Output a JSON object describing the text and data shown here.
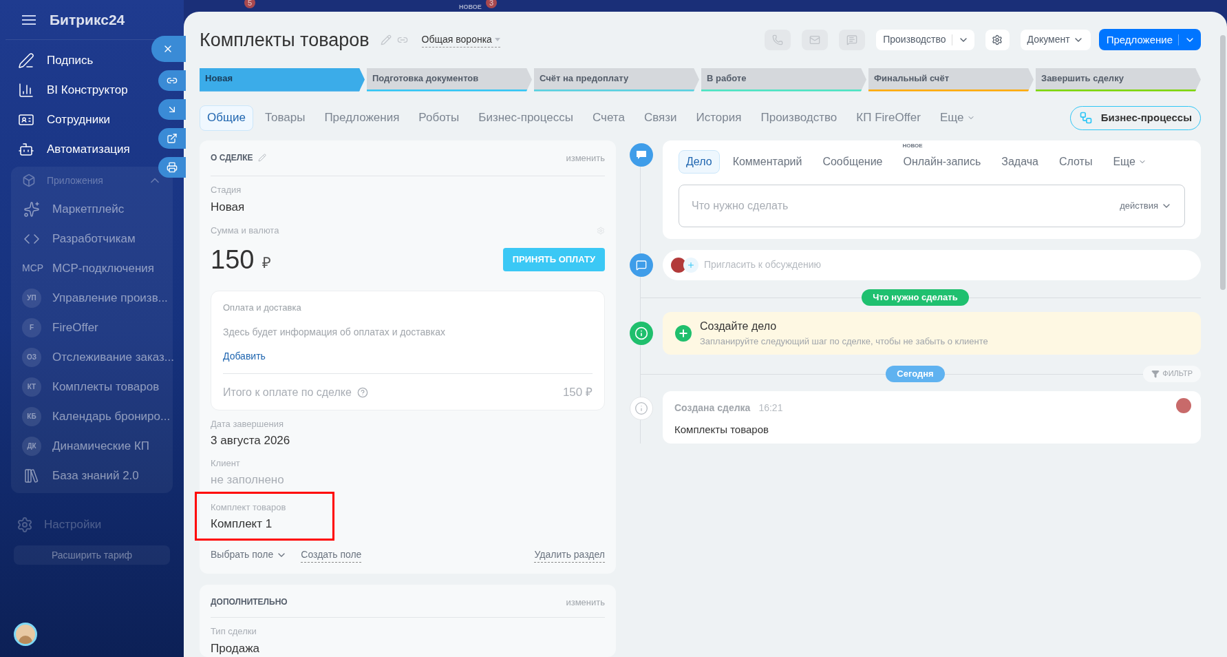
{
  "background_top": {
    "badges": [
      {
        "text": "5"
      },
      {
        "text": "3"
      }
    ],
    "new_label": "НОВОЕ"
  },
  "sidebar": {
    "logo": "Битрикс24",
    "items": [
      {
        "kind": "icon",
        "label": "Подпись",
        "dimmed": false
      },
      {
        "kind": "icon",
        "label": "BI Конструктор",
        "dimmed": false
      },
      {
        "kind": "icon",
        "label": "Сотрудники",
        "dimmed": false
      },
      {
        "kind": "icon",
        "label": "Автоматизация",
        "dimmed": false
      }
    ],
    "group": {
      "label": "Приложения",
      "expanded": true,
      "items": [
        {
          "kind": "icon",
          "label": "Маркетплейс",
          "dimmed": true
        },
        {
          "kind": "icon",
          "label": "Разработчикам",
          "dimmed": true
        },
        {
          "kind": "text_icon",
          "initials": "MCP",
          "label": "MCP-подключения",
          "dimmed": true
        },
        {
          "kind": "initials",
          "initials": "УП",
          "label": "Управление произв...",
          "dimmed": true
        },
        {
          "kind": "initials",
          "initials": "F",
          "label": "FireOffer",
          "dimmed": true
        },
        {
          "kind": "initials",
          "initials": "ОЗ",
          "label": "Отслеживание заказ...",
          "dimmed": true
        },
        {
          "kind": "initials",
          "initials": "КТ",
          "label": "Комплекты товаров",
          "dimmed": true
        },
        {
          "kind": "initials",
          "initials": "КБ",
          "label": "Календарь брониро...",
          "dimmed": true
        },
        {
          "kind": "initials",
          "initials": "ДК",
          "label": "Динамические КП",
          "dimmed": true
        },
        {
          "kind": "icon",
          "label": "База знаний 2.0",
          "dimmed": true
        }
      ]
    },
    "settings": "Настройки",
    "tariff": "Расширить тариф"
  },
  "header": {
    "title": "Комплекты товаров",
    "pipeline": "Общая воронка",
    "production_button": "Производство",
    "document_button": "Документ",
    "primary_button": "Предложение"
  },
  "stages": [
    {
      "label": "Новая",
      "selected": true,
      "color": "#3bace9"
    },
    {
      "label": "Подготовка документов",
      "selected": false,
      "color": "#2fc6f6"
    },
    {
      "label": "Счёт на предоплату",
      "selected": false,
      "color": "#55d0e0"
    },
    {
      "label": "В работе",
      "selected": false,
      "color": "#47e4c2"
    },
    {
      "label": "Финальный счёт",
      "selected": false,
      "color": "#ffa900"
    },
    {
      "label": "Завершить сделку",
      "selected": false,
      "color": "#7bd500"
    }
  ],
  "tabs": [
    {
      "label": "Общие",
      "selected": true
    },
    {
      "label": "Товары",
      "selected": false
    },
    {
      "label": "Предложения",
      "selected": false
    },
    {
      "label": "Роботы",
      "selected": false
    },
    {
      "label": "Бизнес-процессы",
      "selected": false
    },
    {
      "label": "Счета",
      "selected": false
    },
    {
      "label": "Связи",
      "selected": false
    },
    {
      "label": "История",
      "selected": false
    },
    {
      "label": "Производство",
      "selected": false
    },
    {
      "label": "КП FireOffer",
      "selected": false
    },
    {
      "label": "Еще",
      "selected": false
    }
  ],
  "bp_button": "Бизнес-процессы",
  "about": {
    "title": "О СДЕЛКЕ",
    "edit": "изменить",
    "stage": {
      "label": "Стадия",
      "value": "Новая"
    },
    "amount": {
      "label": "Сумма и валюта",
      "value": "150",
      "currency": "₽",
      "button": "ПРИНЯТЬ ОПЛАТУ"
    },
    "payment": {
      "title": "Оплата и доставка",
      "info": "Здесь будет информация об оплатах и доставках",
      "add": "Добавить",
      "total_label": "Итого к оплате по сделке",
      "total_value": "150 ₽"
    },
    "fields": [
      {
        "label": "Дата завершения",
        "value": "3 августа 2026",
        "empty": false,
        "highlighted": false
      },
      {
        "label": "Клиент",
        "value": "не заполнено",
        "empty": true,
        "highlighted": false
      },
      {
        "label": "Комплект товаров",
        "value": "Комплект 1",
        "empty": false,
        "highlighted": true
      }
    ],
    "select_field": "Выбрать поле",
    "create_field": "Создать поле",
    "delete_section": "Удалить раздел"
  },
  "extra": {
    "title": "ДОПОЛНИТЕЛЬНО",
    "edit": "изменить",
    "fields": [
      {
        "label": "Тип сделки",
        "value": "Продажа"
      }
    ]
  },
  "activity": {
    "tabs": [
      {
        "label": "Дело",
        "selected": true
      },
      {
        "label": "Комментарий",
        "selected": false
      },
      {
        "label": "Сообщение",
        "selected": false
      },
      {
        "label": "Онлайн-запись",
        "selected": false,
        "badge": "НОВОЕ"
      },
      {
        "label": "Задача",
        "selected": false
      },
      {
        "label": "Слоты",
        "selected": false
      },
      {
        "label": "Еще",
        "selected": false
      }
    ],
    "placeholder": "Что нужно сделать",
    "actions": "действия"
  },
  "invite": "Пригласить к обсуждению",
  "todo_label": "Что нужно сделать",
  "create": {
    "title": "Создайте дело",
    "text": "Запланируйте следующий шаг по сделке, чтобы не забыть о клиенте"
  },
  "today_label": "Сегодня",
  "filter": "ФИЛЬТР",
  "event": {
    "title": "Создана сделка",
    "time": "16:21",
    "text": "Комплекты товаров"
  }
}
